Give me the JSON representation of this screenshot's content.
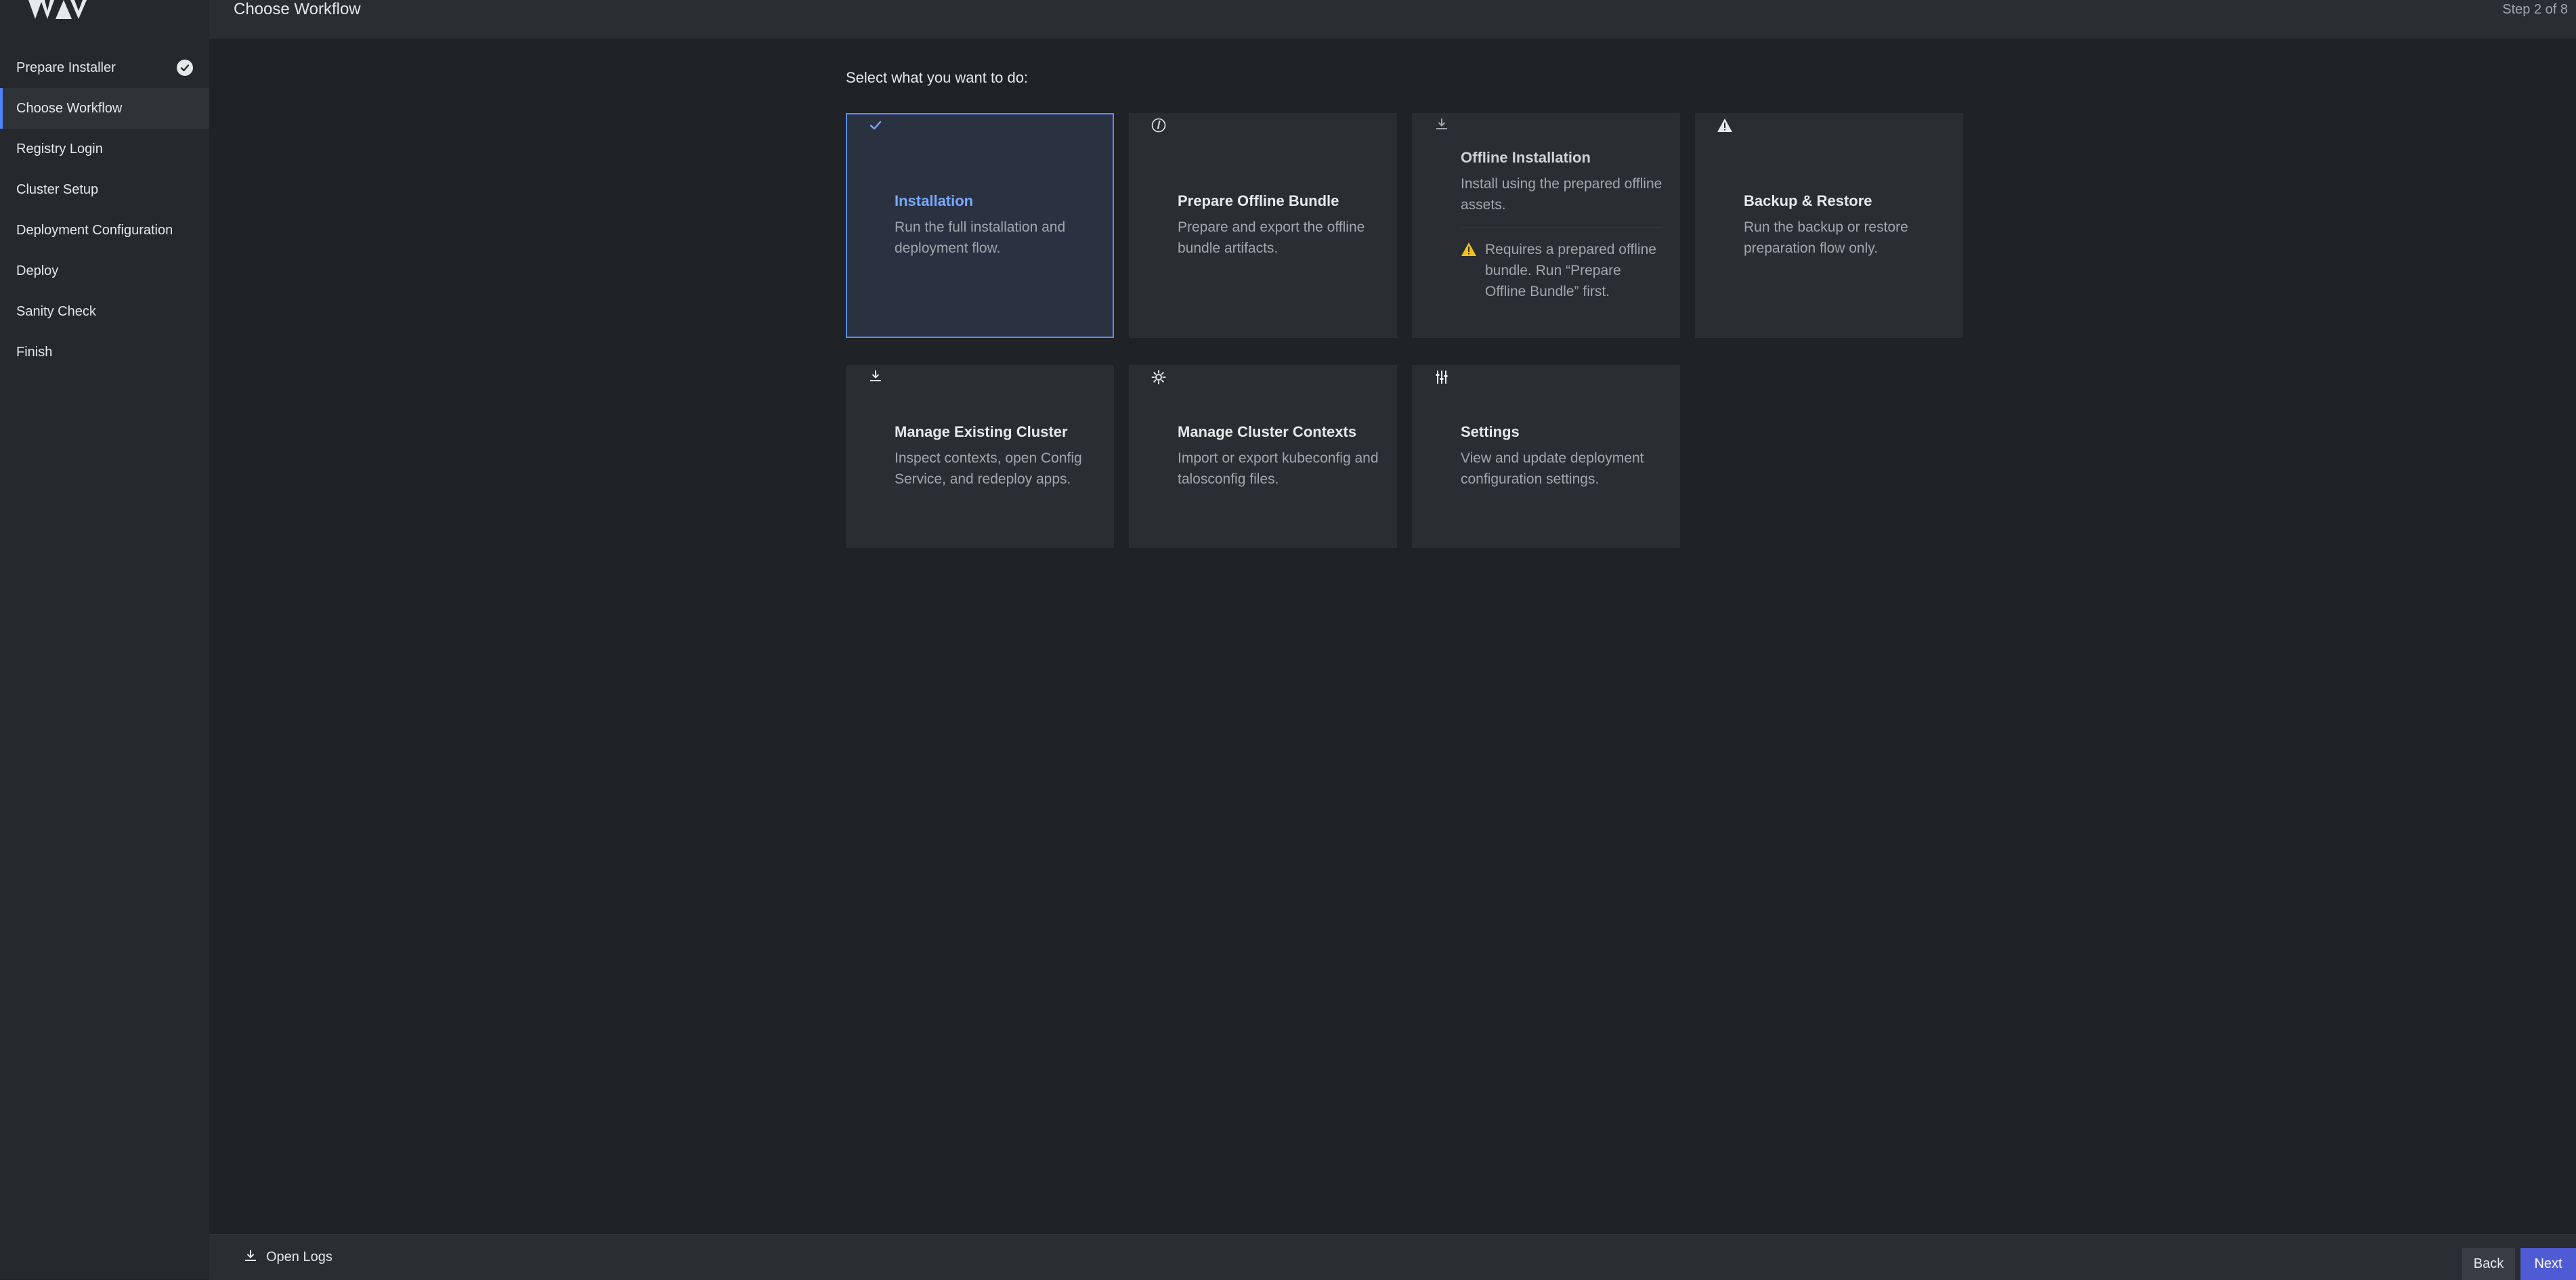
{
  "app": {
    "header_title": "Choose Workflow",
    "step_text": "Step 2 of 8"
  },
  "sidebar": {
    "items": [
      {
        "label": "Prepare Installer",
        "completed": true
      },
      {
        "label": "Choose Workflow",
        "active": true
      },
      {
        "label": "Registry Login"
      },
      {
        "label": "Cluster Setup"
      },
      {
        "label": "Deployment Configuration"
      },
      {
        "label": "Deploy"
      },
      {
        "label": "Sanity Check"
      },
      {
        "label": "Finish"
      }
    ]
  },
  "main": {
    "prompt": "Select what you want to do:",
    "cards": [
      {
        "title": "Installation",
        "desc": "Run the full installation and deployment flow.",
        "icon": "check-icon",
        "selected": true
      },
      {
        "title": "Prepare Offline Bundle",
        "desc": "Prepare and export the offline bundle artifacts.",
        "icon": "info-icon"
      },
      {
        "title": "Offline Installation",
        "desc": "Install using the prepared offline assets.",
        "icon": "download-icon",
        "warning": "Requires a prepared offline bundle. Run “Prepare Offline Bundle” first."
      },
      {
        "title": "Backup & Restore",
        "desc": "Run the backup or restore preparation flow only.",
        "icon": "warning-icon"
      },
      {
        "title": "Manage Existing Cluster",
        "desc": "Inspect contexts, open Config Service, and redeploy apps.",
        "icon": "download-icon"
      },
      {
        "title": "Manage Cluster Contexts",
        "desc": "Import or export kubeconfig and talosconfig files.",
        "icon": "gear-icon"
      },
      {
        "title": "Settings",
        "desc": "View and update deployment configuration settings.",
        "icon": "sliders-icon"
      }
    ]
  },
  "footer": {
    "open_logs": "Open Logs",
    "back": "Back",
    "next": "Next"
  },
  "colors": {
    "accent": "#4c83ff",
    "next_button": "#4f5bd5",
    "warning": "#f1c21b"
  }
}
